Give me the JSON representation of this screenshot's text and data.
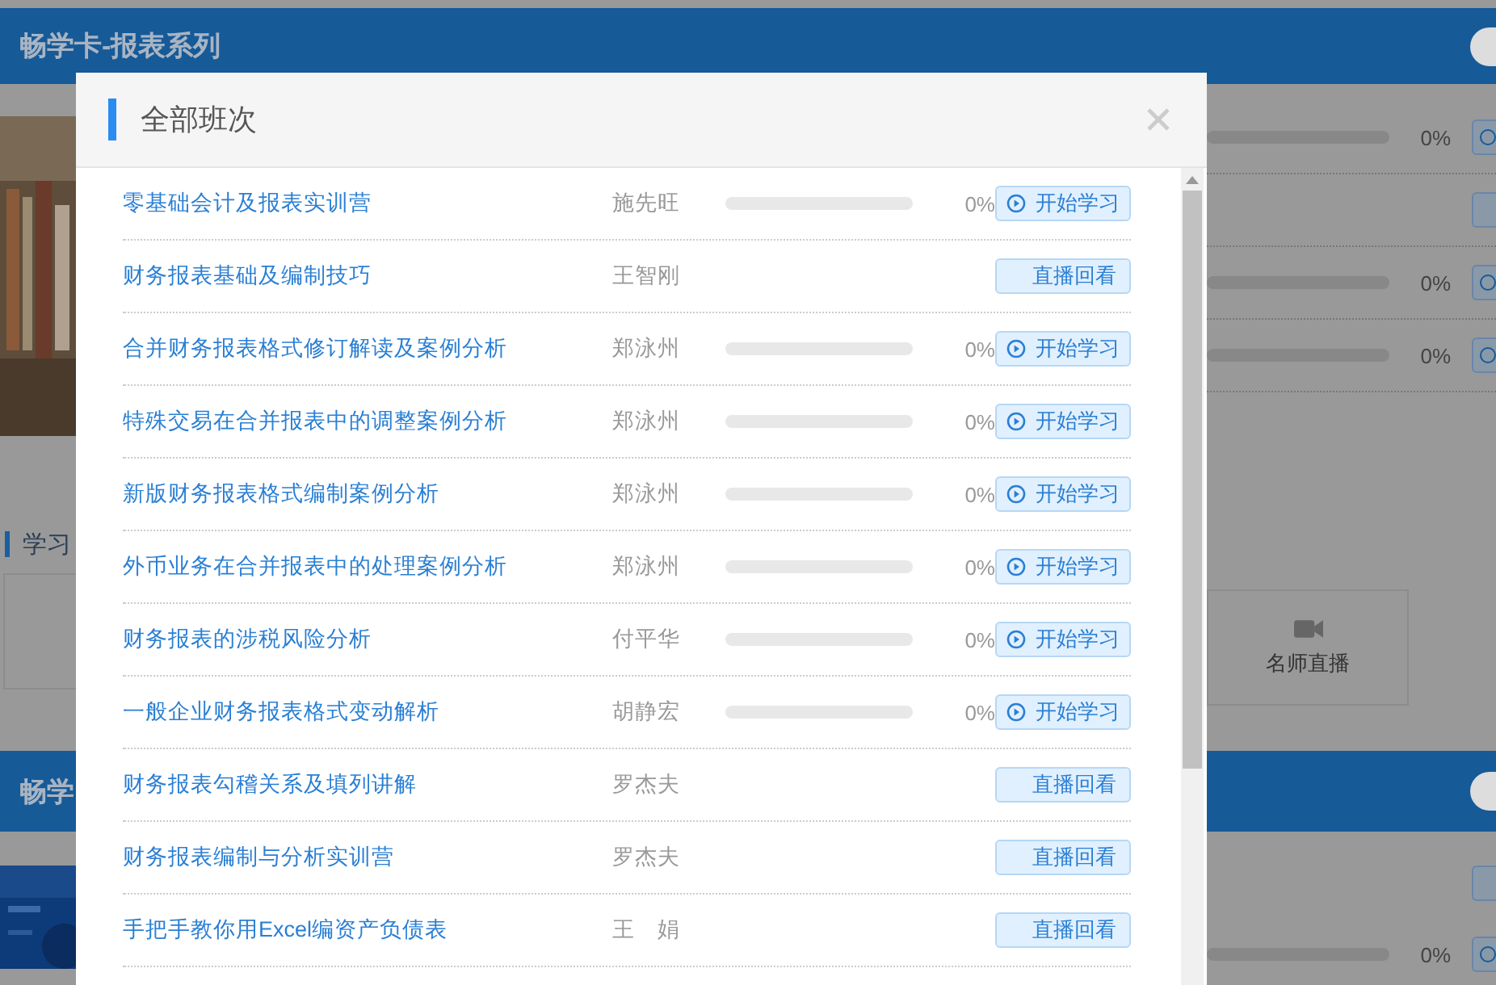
{
  "background": {
    "header": {
      "title": "畅学卡-报表系列",
      "switch_on": true
    },
    "side_rows": [
      {
        "kind": "progress",
        "level": 0,
        "percent": "0%"
      },
      {
        "kind": "button"
      },
      {
        "kind": "progress",
        "level": 0,
        "percent": "0%"
      },
      {
        "kind": "progress",
        "level": 0,
        "percent": "0%"
      }
    ],
    "section_title": "学习",
    "tile": {
      "label": "名师直播"
    },
    "header2": {
      "title": "畅学",
      "switch_on": true
    },
    "bottom_rows": [
      {
        "kind": "button"
      },
      {
        "kind": "progress",
        "level": 0,
        "percent": "0%"
      }
    ]
  },
  "dialog": {
    "title": "全部班次",
    "courses": [
      {
        "title": "零基础会计及报表实训营",
        "teacher": "施先旺",
        "kind": "start",
        "level": 0,
        "percent": "0%",
        "button": "开始学习"
      },
      {
        "title": "财务报表基础及编制技巧",
        "teacher": "王智刚",
        "kind": "replay",
        "button": "直播回看"
      },
      {
        "title": "合并财务报表格式修订解读及案例分析",
        "teacher": "郑泳州",
        "kind": "start",
        "level": 0,
        "percent": "0%",
        "button": "开始学习"
      },
      {
        "title": "特殊交易在合并报表中的调整案例分析",
        "teacher": "郑泳州",
        "kind": "start",
        "level": 0,
        "percent": "0%",
        "button": "开始学习"
      },
      {
        "title": "新版财务报表格式编制案例分析",
        "teacher": "郑泳州",
        "kind": "start",
        "level": 0,
        "percent": "0%",
        "button": "开始学习"
      },
      {
        "title": "外币业务在合并报表中的处理案例分析",
        "teacher": "郑泳州",
        "kind": "start",
        "level": 0,
        "percent": "0%",
        "button": "开始学习"
      },
      {
        "title": "财务报表的涉税风险分析",
        "teacher": "付平华",
        "kind": "start",
        "level": 0,
        "percent": "0%",
        "button": "开始学习"
      },
      {
        "title": "一般企业财务报表格式变动解析",
        "teacher": "胡静宏",
        "kind": "start",
        "level": 0,
        "percent": "0%",
        "button": "开始学习"
      },
      {
        "title": "财务报表勾稽关系及填列讲解",
        "teacher": "罗杰夫",
        "kind": "replay",
        "button": "直播回看"
      },
      {
        "title": "财务报表编制与分析实训营",
        "teacher": "罗杰夫",
        "kind": "replay",
        "button": "直播回看"
      },
      {
        "title": "手把手教你用Excel编资产负债表",
        "teacher": "王　娟",
        "kind": "replay",
        "button": "直播回看"
      }
    ]
  }
}
